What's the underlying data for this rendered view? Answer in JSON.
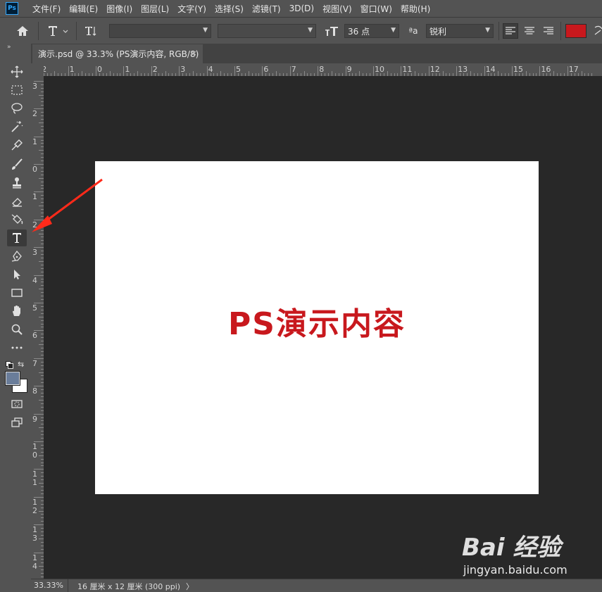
{
  "app": {
    "logo": "Ps"
  },
  "menu": [
    "文件(F)",
    "编辑(E)",
    "图像(I)",
    "图层(L)",
    "文字(Y)",
    "选择(S)",
    "滤镜(T)",
    "3D(D)",
    "视图(V)",
    "窗口(W)",
    "帮助(H)"
  ],
  "options": {
    "font_family": "",
    "font_style": "",
    "font_size": "36 点",
    "aa_label": "ªa",
    "antialias": "锐利",
    "text_color": "#c8181d"
  },
  "tab": {
    "title": "演示.psd @ 33.3% (PS演示内容, RGB/8)",
    "close": "×"
  },
  "rulers": {
    "h": [
      "2",
      "1",
      "0",
      "1",
      "2",
      "3",
      "4",
      "5",
      "6",
      "7",
      "8",
      "9",
      "10",
      "11",
      "12",
      "13",
      "14",
      "15",
      "16",
      "17"
    ],
    "v": [
      "3",
      "2",
      "1",
      "0",
      "1",
      "2",
      "3",
      "4",
      "5",
      "6",
      "7",
      "8",
      "9",
      "1\n0",
      "1\n1",
      "1\n2",
      "1\n3",
      "1\n4"
    ]
  },
  "document": {
    "text": "PS演示内容"
  },
  "status": {
    "zoom": "33.33%",
    "doc_info": "16 厘米 x 12 厘米 (300 ppi)",
    "more": "〉"
  },
  "watermark": {
    "logo": "Bai 经验",
    "url": "jingyan.baidu.com"
  },
  "colors": {
    "accent_red": "#c8181d",
    "foreground": "#6a7d9a",
    "background": "#ffffff"
  },
  "tools": [
    "move-icon",
    "marquee-icon",
    "lasso-icon",
    "magic-wand-icon",
    "eyedropper-icon",
    "brush-icon",
    "stamp-icon",
    "eraser-icon",
    "paint-bucket-icon",
    "type-icon",
    "pen-icon",
    "path-select-icon",
    "rectangle-icon",
    "hand-icon",
    "zoom-icon",
    "more-tools-icon",
    "swap-colors-icon",
    "quick-mask-icon",
    "screen-mode-icon"
  ]
}
